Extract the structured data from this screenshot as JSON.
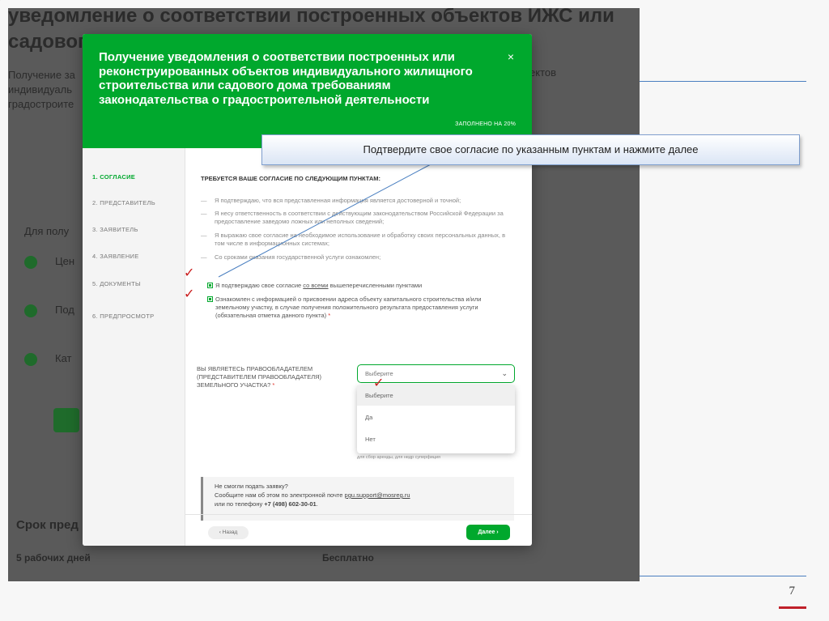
{
  "background_page": {
    "title_line1": "уведомление о соответствии построенных объектов ИЖС или",
    "title_line2": "садового",
    "intro_lines": [
      "Получение за",
      "индивидуаль",
      "градостроите"
    ],
    "intro_right": "ектов",
    "side_label": "Для полу",
    "steps": [
      "Цен",
      "Под",
      "Кат"
    ],
    "term_heading": "Срок пред",
    "term_value": "5 рабочих дней",
    "cost_value": "Бесплатно"
  },
  "modal": {
    "title": "Получение уведомления о соответствии построенных или реконструированных объектов индивидуального жилищного строительства или садового дома требованиям законодательства о градостроительной деятельности",
    "close": "×",
    "progress_label": "ЗАПОЛНЕНО НА 20%",
    "progress_percent": 20,
    "steps": [
      {
        "label": "1.  СОГЛАСИЕ",
        "active": true
      },
      {
        "label": "2.  ПРЕДСТАВИТЕЛЬ",
        "active": false
      },
      {
        "label": "3.  ЗАЯВИТЕЛЬ",
        "active": false
      },
      {
        "label": "4.  ЗАЯВЛЕНИЕ",
        "active": false
      },
      {
        "label": "5.  ДОКУМЕНТЫ",
        "active": false
      },
      {
        "label": "6.  ПРЕДПРОСМОТР",
        "active": false
      }
    ],
    "consent_heading": "ТРЕБУЕТСЯ ВАШЕ СОГЛАСИЕ ПО СЛЕДУЮЩИМ ПУНКТАМ:",
    "points": [
      "Я подтверждаю, что вся представленная информация является достоверной и точной;",
      "Я несу ответственность в соответствии с действующим законодательством Российской Федерации за предоставление заведомо ложных или неполных сведений;",
      "Я выражаю свое согласие на необходимое использование и обработку своих персональных данных, в том числе в информационных системах;",
      "Со сроками оказания государственной услуги ознакомлен;"
    ],
    "agree_all_prefix": "Я подтверждаю свое согласие ",
    "agree_all_link": "со всеми",
    "agree_all_suffix": " вышеперечисленными пунктами",
    "address_notice": "Ознакомлен с информацией о присвоении адреса объекту капитального строительства и/или земельному участку, в случае получения положительного результата предоставления услуги (обязательная отметка данного пункта)",
    "required_mark": "*",
    "owner_question": "ВЫ ЯВЛЯЕТЕСЬ ПРАВООБЛАДАТЕЛЕМ (ПРЕДСТАВИТЕЛЕМ ПРАВООБЛАДАТЕЛЯ) ЗЕМЕЛЬНОГО УЧАСТКА?",
    "select_value": "Выберите",
    "select_options": [
      "Выберите",
      "Да",
      "Нет"
    ],
    "helper_text": "для сбор аренды, для недр суперфиция",
    "help_title": "Не смогли подать заявку?",
    "help_email_prefix": "Сообщите нам об этом по электронной почте ",
    "help_email": "pgu.support@mosreg.ru",
    "help_phone_prefix": "или по телефону ",
    "help_phone": "+7 (498) 602-30-01",
    "help_phone_suffix": ".",
    "back_label": "‹  Назад",
    "next_label": "Далее  ›"
  },
  "annotation": {
    "callout_text": "Подтвердите свое согласие по указанным пунктам и нажмите далее",
    "tick": "✓"
  },
  "slide": {
    "page_number": "7"
  },
  "colors": {
    "accent_green": "#00a82d",
    "callout_border": "#7f9fcf",
    "tick_red": "#c91c1c"
  }
}
